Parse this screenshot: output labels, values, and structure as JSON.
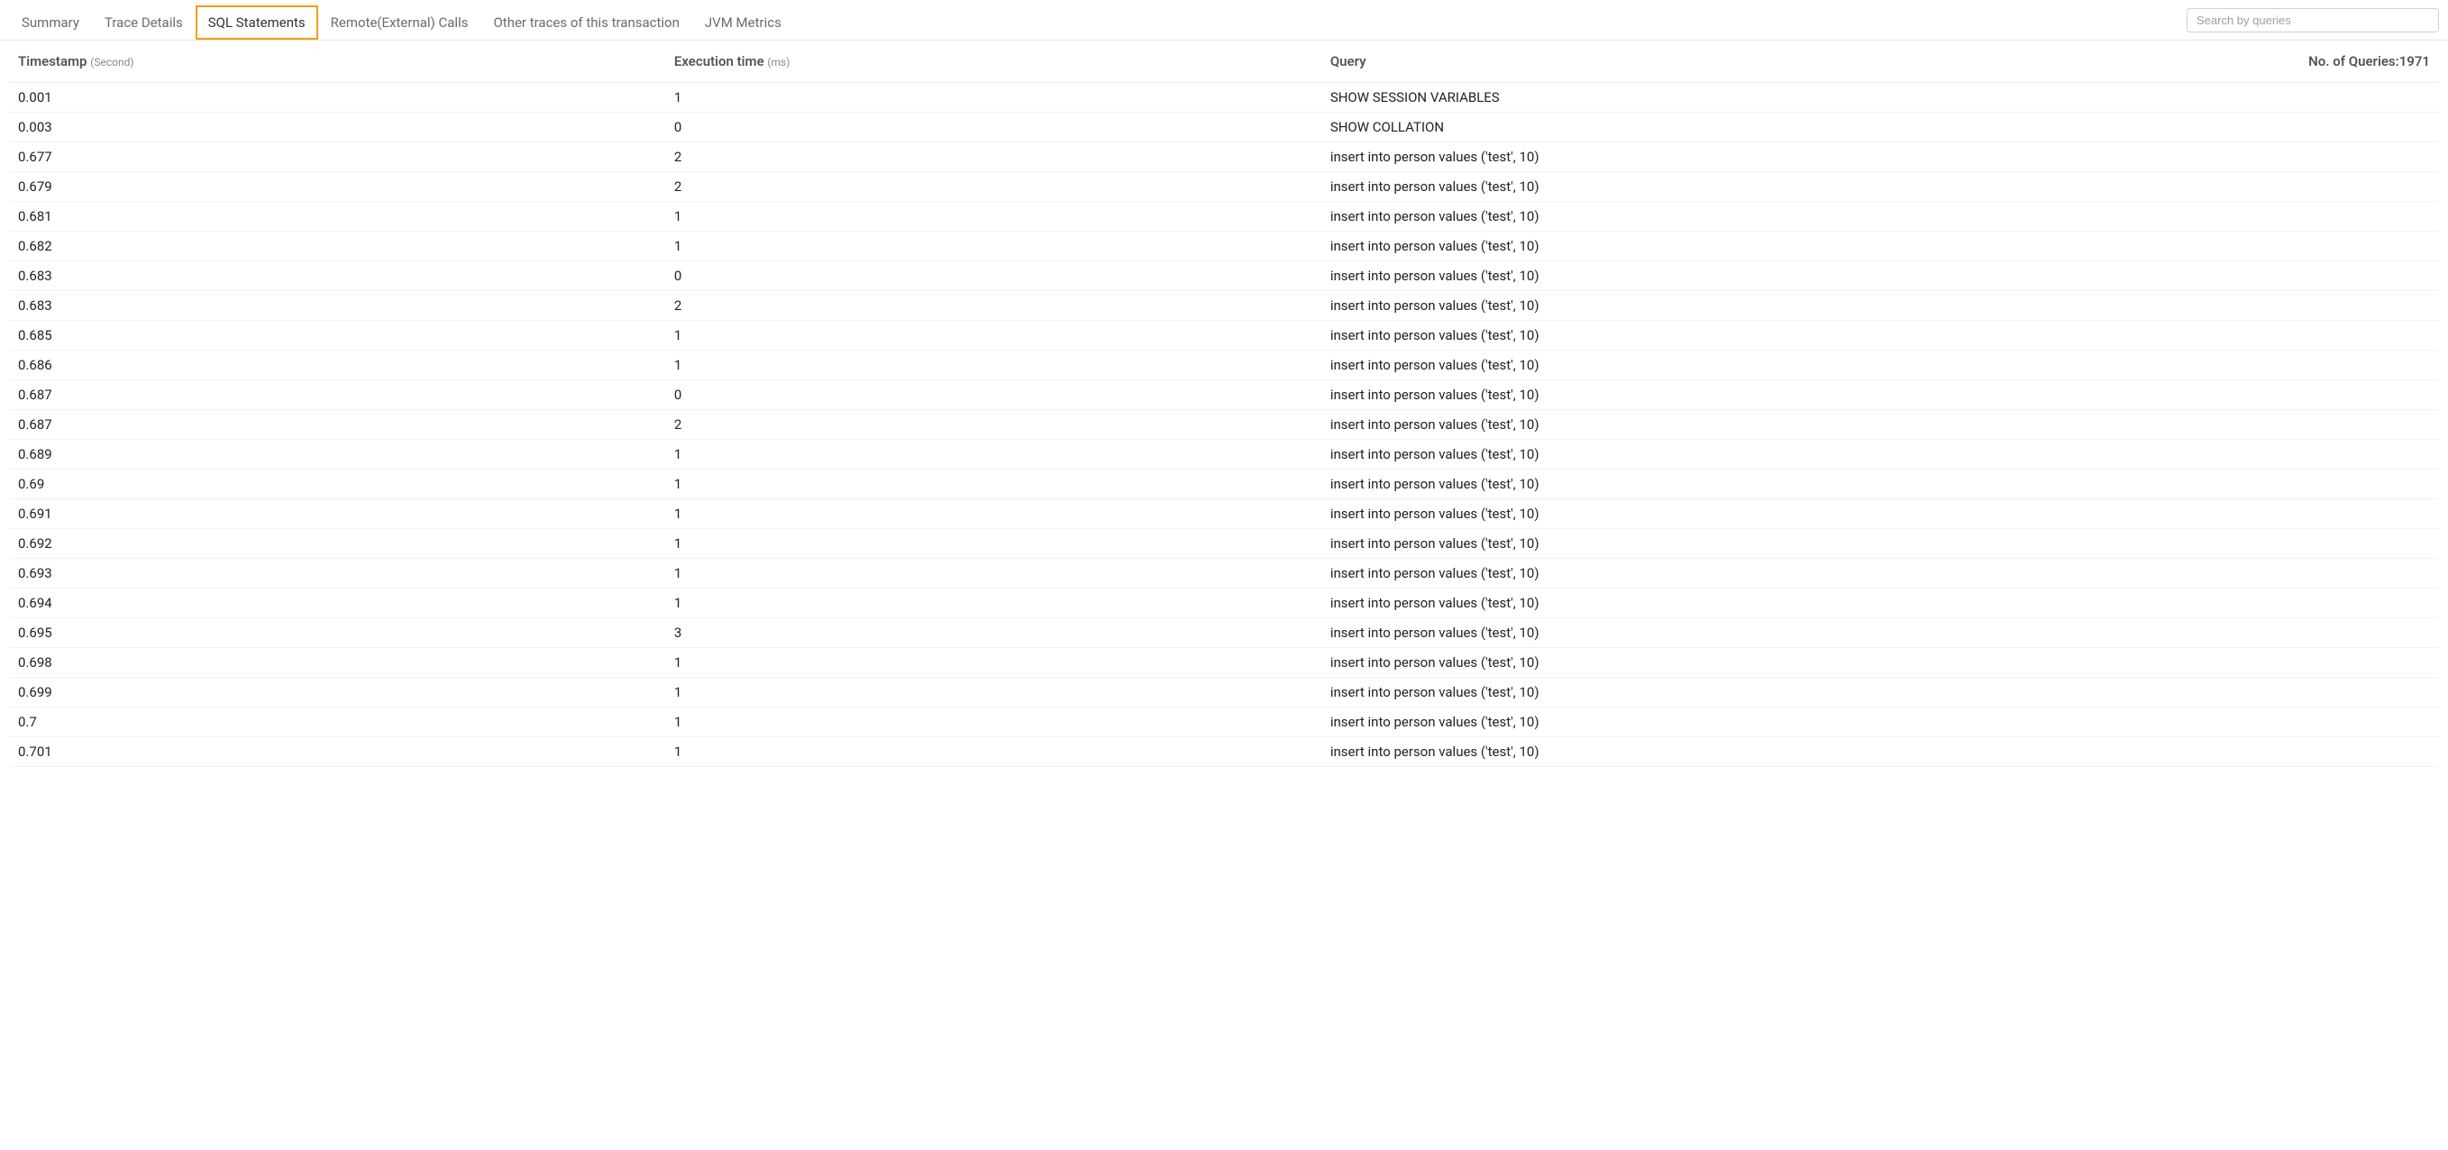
{
  "tabs": [
    {
      "label": "Summary",
      "active": false
    },
    {
      "label": "Trace Details",
      "active": false
    },
    {
      "label": "SQL Statements",
      "active": true
    },
    {
      "label": "Remote(External) Calls",
      "active": false
    },
    {
      "label": "Other traces of this transaction",
      "active": false
    },
    {
      "label": "JVM Metrics",
      "active": false
    }
  ],
  "search": {
    "placeholder": "Search by queries"
  },
  "columns": {
    "timestamp_label": "Timestamp",
    "timestamp_unit": "(Second)",
    "exec_label": "Execution time",
    "exec_unit": "(ms)",
    "query_label": "Query",
    "count_label": "No. of Queries:",
    "count_value": "1971"
  },
  "rows": [
    {
      "ts": "0.001",
      "exec": "1",
      "query": "SHOW SESSION VARIABLES"
    },
    {
      "ts": "0.003",
      "exec": "0",
      "query": "SHOW COLLATION"
    },
    {
      "ts": "0.677",
      "exec": "2",
      "query": "insert into person values ('test', 10)"
    },
    {
      "ts": "0.679",
      "exec": "2",
      "query": "insert into person values ('test', 10)"
    },
    {
      "ts": "0.681",
      "exec": "1",
      "query": "insert into person values ('test', 10)"
    },
    {
      "ts": "0.682",
      "exec": "1",
      "query": "insert into person values ('test', 10)"
    },
    {
      "ts": "0.683",
      "exec": "0",
      "query": "insert into person values ('test', 10)"
    },
    {
      "ts": "0.683",
      "exec": "2",
      "query": "insert into person values ('test', 10)"
    },
    {
      "ts": "0.685",
      "exec": "1",
      "query": "insert into person values ('test', 10)"
    },
    {
      "ts": "0.686",
      "exec": "1",
      "query": "insert into person values ('test', 10)"
    },
    {
      "ts": "0.687",
      "exec": "0",
      "query": "insert into person values ('test', 10)"
    },
    {
      "ts": "0.687",
      "exec": "2",
      "query": "insert into person values ('test', 10)"
    },
    {
      "ts": "0.689",
      "exec": "1",
      "query": "insert into person values ('test', 10)"
    },
    {
      "ts": "0.69",
      "exec": "1",
      "query": "insert into person values ('test', 10)"
    },
    {
      "ts": "0.691",
      "exec": "1",
      "query": "insert into person values ('test', 10)"
    },
    {
      "ts": "0.692",
      "exec": "1",
      "query": "insert into person values ('test', 10)"
    },
    {
      "ts": "0.693",
      "exec": "1",
      "query": "insert into person values ('test', 10)"
    },
    {
      "ts": "0.694",
      "exec": "1",
      "query": "insert into person values ('test', 10)"
    },
    {
      "ts": "0.695",
      "exec": "3",
      "query": "insert into person values ('test', 10)"
    },
    {
      "ts": "0.698",
      "exec": "1",
      "query": "insert into person values ('test', 10)"
    },
    {
      "ts": "0.699",
      "exec": "1",
      "query": "insert into person values ('test', 10)"
    },
    {
      "ts": "0.7",
      "exec": "1",
      "query": "insert into person values ('test', 10)"
    },
    {
      "ts": "0.701",
      "exec": "1",
      "query": "insert into person values ('test', 10)"
    }
  ]
}
